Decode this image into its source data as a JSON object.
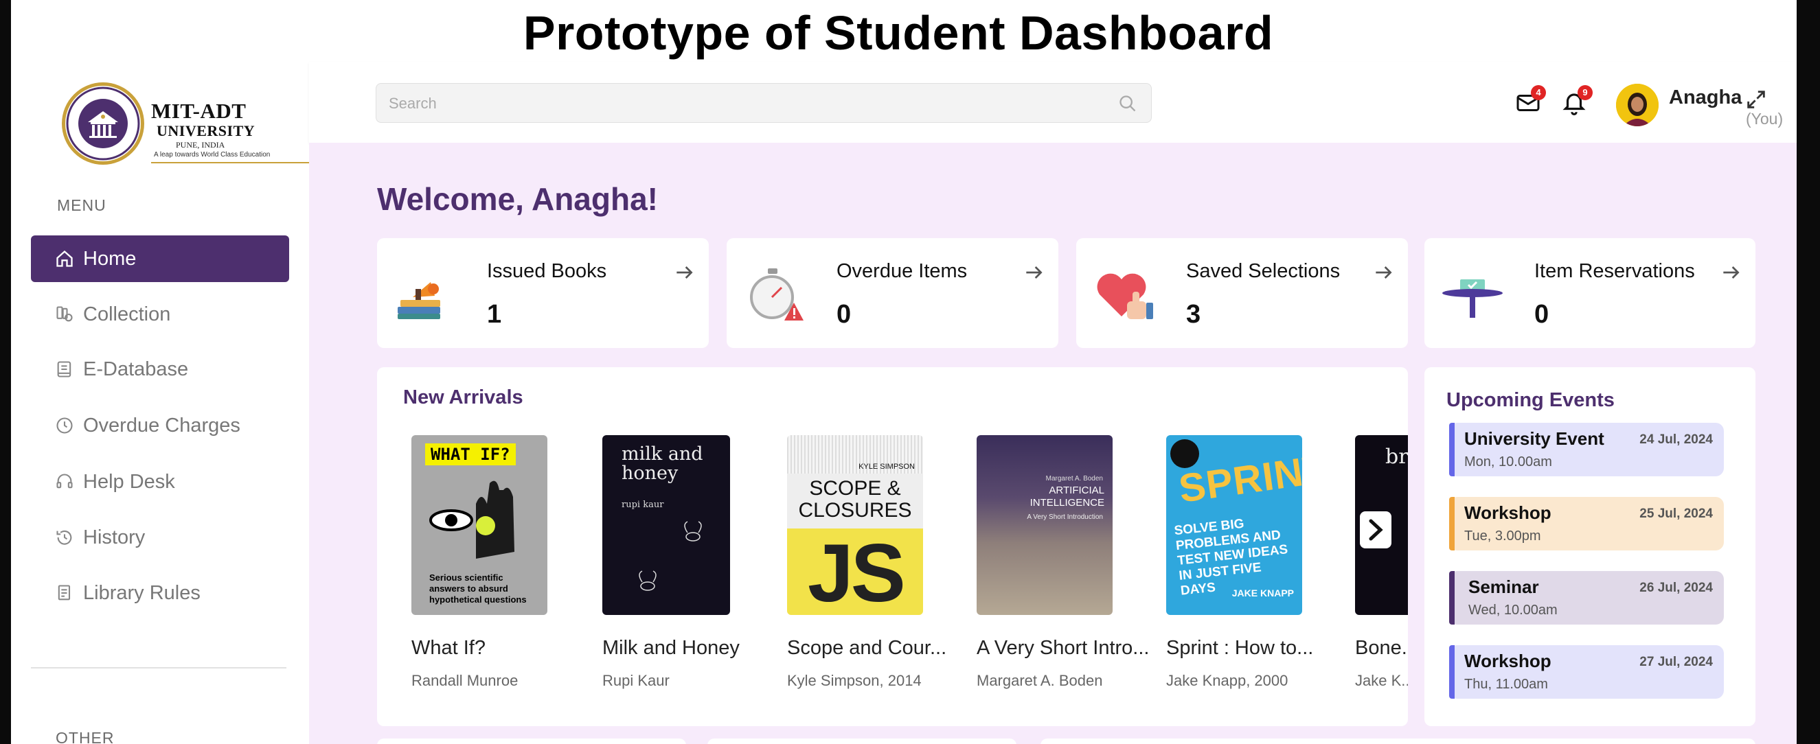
{
  "page_title": "Prototype of Student Dashboard",
  "logo": {
    "name": "MIT-ADT",
    "sub": "UNIVERSITY",
    "location": "PUNE, INDIA",
    "tagline": "A leap towards World Class Education"
  },
  "sidebar": {
    "menu_heading": "MENU",
    "items": [
      {
        "label": "Home",
        "icon": "home-icon",
        "active": true
      },
      {
        "label": "Collection",
        "icon": "collection-icon"
      },
      {
        "label": "E-Database",
        "icon": "book-icon"
      },
      {
        "label": "Overdue Charges",
        "icon": "clock-charge-icon"
      },
      {
        "label": "Help Desk",
        "icon": "headset-icon"
      },
      {
        "label": "History",
        "icon": "history-icon"
      },
      {
        "label": "Library Rules",
        "icon": "rules-icon"
      }
    ],
    "other_heading": "OTHER"
  },
  "topbar": {
    "search_placeholder": "Search",
    "mail_count": "4",
    "notification_count": "9",
    "user_name": "Anagha",
    "user_role": "(You)"
  },
  "welcome": "Welcome, Anagha!",
  "stats": [
    {
      "title": "Issued Books",
      "value": "1",
      "icon": "books-megaphone-icon"
    },
    {
      "title": "Overdue Items",
      "value": "0",
      "icon": "stopwatch-warning-icon"
    },
    {
      "title": "Saved Selections",
      "value": "3",
      "icon": "heart-thumbs-up-icon"
    },
    {
      "title": "Item Reservations",
      "value": "0",
      "icon": "reservation-stand-icon"
    }
  ],
  "new_arrivals": {
    "title": "New Arrivals",
    "books": [
      {
        "title": "What If?",
        "author": "Randall Munroe",
        "cover_heading": "WHAT IF?",
        "cover_text": "Serious scientific answers to absurd hypothetical questions"
      },
      {
        "title": "Milk and Honey",
        "author": "Rupi Kaur",
        "cover_heading": "milk and honey",
        "cover_author": "rupi kaur"
      },
      {
        "title": "Scope and Cour...",
        "author": "Kyle Simpson, 2014",
        "cover_author": "KYLE SIMPSON",
        "cover_heading": "SCOPE & CLOSURES",
        "cover_js": "JS"
      },
      {
        "title": "A Very Short Intro...",
        "author": "Margaret A. Boden",
        "cover_author": "Margaret A. Boden",
        "cover_heading": "ARTIFICIAL INTELLIGENCE",
        "cover_sub": "A Very Short Introduction"
      },
      {
        "title": "Sprint : How to...",
        "author": "Jake Knapp, 2000",
        "cover_heading": "SPRINT",
        "cover_text": "SOLVE BIG PROBLEMS AND TEST NEW IDEAS IN JUST FIVE DAYS",
        "cover_author": "JAKE KNAPP"
      },
      {
        "title": "Bone...",
        "author": "Jake K...",
        "cover_heading": "bri"
      }
    ]
  },
  "events": {
    "title": "Upcoming Events",
    "items": [
      {
        "name": "University Event",
        "date": "24 Jul, 2024",
        "time": "Mon, 10.00am",
        "bg": "#e3e3fb",
        "bar": "#6466e8"
      },
      {
        "name": "Workshop",
        "date": "25 Jul, 2024",
        "time": "Tue, 3.00pm",
        "bg": "#fbe8cf",
        "bar": "#f0a43a"
      },
      {
        "name": "Seminar",
        "date": "26 Jul, 2024",
        "time": "Wed, 10.00am",
        "bg": "#e0d9e8",
        "bar": "#4d2f6e"
      },
      {
        "name": "Workshop",
        "date": "27 Jul, 2024",
        "time": "Thu, 11.00am",
        "bg": "#e3e3fb",
        "bar": "#6466e8"
      }
    ]
  },
  "colors": {
    "brand": "#4d2f6e",
    "content_bg": "#f7ebfb",
    "badge": "#e02424"
  }
}
